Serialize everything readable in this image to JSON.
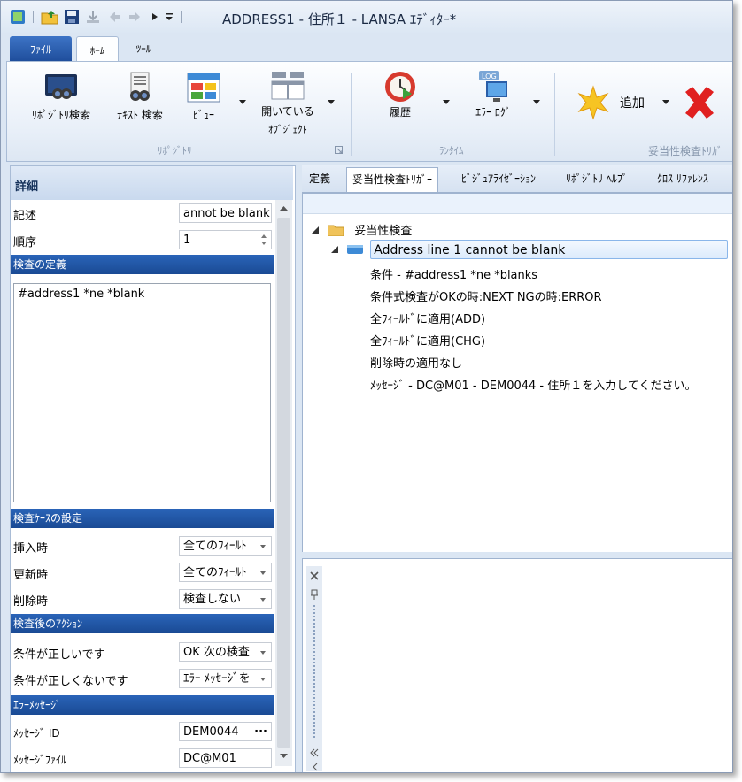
{
  "title": "ADDRESS1 - 住所１ - LANSA ｴﾃﾞｨﾀｰ*",
  "ribbon_tabs": {
    "file": "ﾌｧｲﾙ",
    "home": "ﾎｰﾑ",
    "tool": "ﾂｰﾙ"
  },
  "ribbon": {
    "repo_search": "ﾘﾎﾟｼﾞﾄﾘ検索",
    "text_search": "ﾃｷｽﾄ 検索",
    "view": "ﾋﾞｭｰ",
    "open_objects_1": "開いている",
    "open_objects_2": "ｵﾌﾞｼﾞｪｸﾄ",
    "group_repo": "ﾘﾎﾟｼﾞﾄﾘ",
    "history": "履歴",
    "error_log": "ｴﾗｰ ﾛｸﾞ",
    "group_runtime": "ﾗﾝﾀｲﾑ",
    "add": "追加",
    "group_trigger": "妥当性検査ﾄﾘｶﾞ"
  },
  "left": {
    "header": "詳細",
    "desc_label": "記述",
    "desc_value": "annot be blank",
    "order_label": "順序",
    "order_value": "1",
    "check_def": "検査の定義",
    "expression": "#address1 *ne *blank",
    "case_settings": "検査ｹｰｽの設定",
    "insert_label": "挿入時",
    "insert_value": "全てのﾌｨｰﾙﾄ",
    "update_label": "更新時",
    "update_value": "全てのﾌｨｰﾙﾄ",
    "delete_label": "削除時",
    "delete_value": "検査しない",
    "after_actions": "検査後のｱｸｼｮﾝ",
    "true_label": "条件が正しいです",
    "true_value": "OK 次の検査",
    "false_label": "条件が正しくないです",
    "false_value": "ｴﾗｰ ﾒｯｾｰｼﾞを",
    "error_msg": "ｴﾗｰﾒｯｾｰｼﾞ",
    "msgid_label": "ﾒｯｾｰｼﾞ ID",
    "msgid_value": "DEM0044",
    "msgfile_label": "ﾒｯｾｰｼﾞﾌｧｲﾙ",
    "msgfile_value": "DC@M01"
  },
  "right_tabs": [
    "定義",
    "妥当性検査ﾄﾘｶﾞｰ",
    "ﾋﾞｼﾞｭｱﾗｲｾﾞｰｼｮﾝ",
    "ﾘﾎﾟｼﾞﾄﾘ ﾍﾙﾌﾟ",
    "ｸﾛｽ ﾘﾌｧﾚﾝｽ"
  ],
  "tree": {
    "root": "妥当性検査",
    "selected": "Address line 1 cannot be blank",
    "children": [
      "条件 - #address1 *ne *blanks",
      "条件式検査がOKの時:NEXT NGの時:ERROR",
      "全ﾌｨｰﾙﾄﾞに適用(ADD)",
      "全ﾌｨｰﾙﾄﾞに適用(CHG)",
      "削除時の適用なし",
      "ﾒｯｾｰｼﾞ - DC@M01 - DEM0044 - 住所１を入力してください。"
    ]
  },
  "colors": {
    "section": "#1f4f9a",
    "accent": "#2a64b8"
  }
}
